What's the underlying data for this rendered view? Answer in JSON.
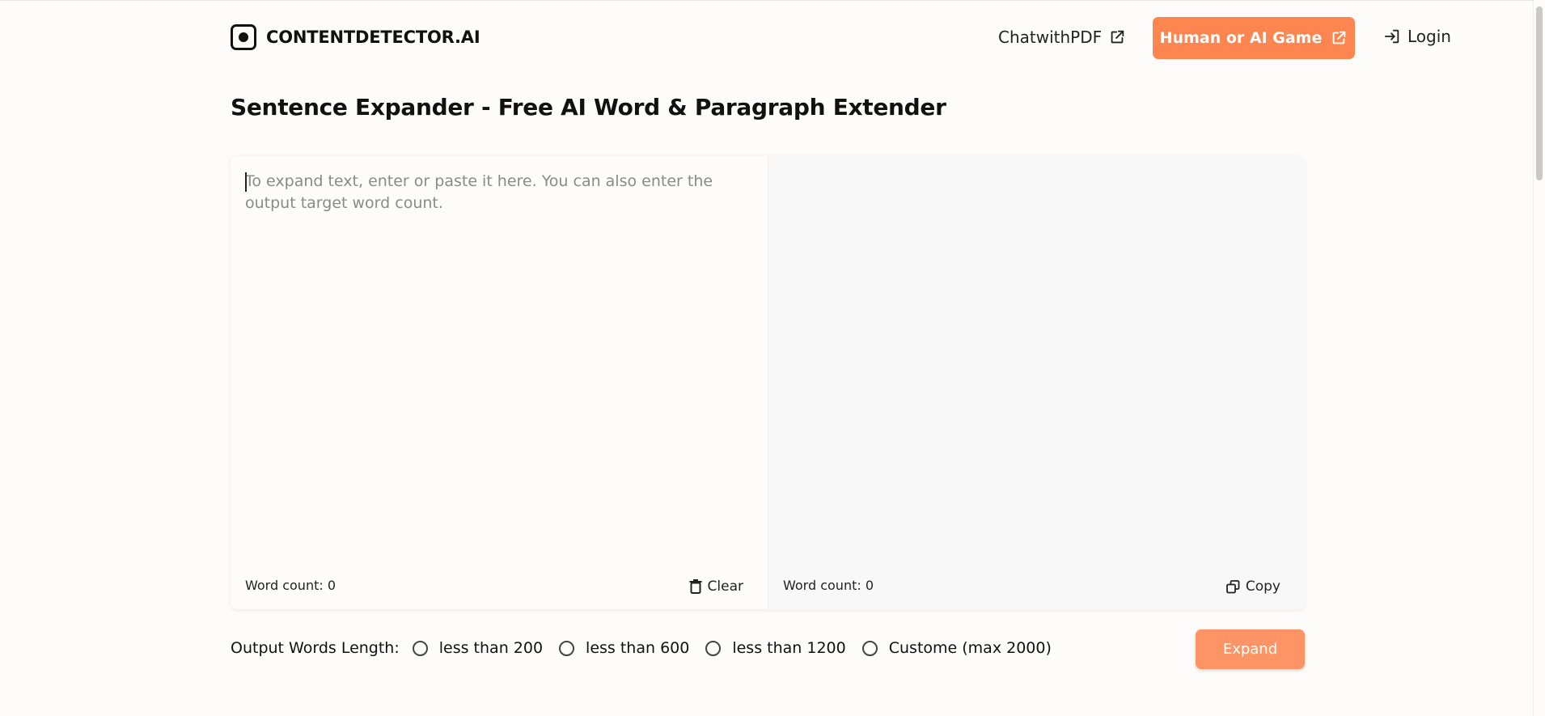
{
  "header": {
    "logo_text": "CONTENTDETECTOR.AI",
    "logo_icon": "record-square-icon",
    "nav_chatpdf": "ChatwithPDF",
    "game_button": "Human or AI Game",
    "login": "Login",
    "accent_color": "#fd8550"
  },
  "page": {
    "title": "Sentence Expander - Free AI Word & Paragraph Extender"
  },
  "editor": {
    "input_placeholder": "To expand text, enter or paste it here. You can also enter the output target word count.",
    "input_value": "",
    "input_word_count": "Word count: 0",
    "clear_label": "Clear",
    "output_word_count": "Word count: 0",
    "copy_label": "Copy"
  },
  "options": {
    "label": "Output Words Length:",
    "choices": [
      "less than 200",
      "less than 600",
      "less than 1200",
      "Custome (max 2000)"
    ],
    "selected": null
  },
  "actions": {
    "expand_label": "Expand"
  }
}
